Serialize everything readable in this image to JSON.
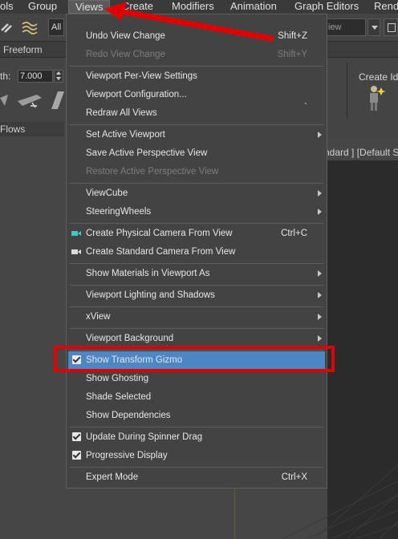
{
  "menubar": {
    "items": [
      "ols",
      "Group",
      "Views",
      "Create",
      "Modifiers",
      "Animation",
      "Graph Editors",
      "Rende"
    ]
  },
  "toolbar": {
    "selection_filter": "All",
    "view_dropdown": "iew"
  },
  "ribbon": {
    "tab_freeform": "Freeform",
    "width_label": "th:",
    "width_value": "7.000",
    "flows_label": "Flows",
    "create_idle_label": "Create Id"
  },
  "viewport": {
    "label": "ndard ] [Default S"
  },
  "views_menu": {
    "items": [
      {
        "label": "Undo View Change",
        "shortcut": "Shift+Z"
      },
      {
        "label": "Redo View Change",
        "shortcut": "Shift+Y"
      },
      {
        "label": "Viewport Per-View Settings"
      },
      {
        "label": "Viewport Configuration..."
      },
      {
        "label": "Redraw All Views",
        "shortcut": "`"
      },
      {
        "label": "Set Active Viewport"
      },
      {
        "label": "Save Active Perspective View"
      },
      {
        "label": "Restore Active Perspective View"
      },
      {
        "label": "ViewCube"
      },
      {
        "label": "SteeringWheels"
      },
      {
        "label": "Create Physical Camera From View",
        "shortcut": "Ctrl+C",
        "icon": "physical-camera-icon"
      },
      {
        "label": "Create Standard Camera From View",
        "icon": "standard-camera-icon"
      },
      {
        "label": "Show Materials in Viewport As"
      },
      {
        "label": "Viewport Lighting and Shadows"
      },
      {
        "label": "xView"
      },
      {
        "label": "Viewport Background"
      },
      {
        "label": "Show Transform Gizmo",
        "checked": true,
        "highlighted": true
      },
      {
        "label": "Show Ghosting"
      },
      {
        "label": "Shade Selected"
      },
      {
        "label": "Show Dependencies"
      },
      {
        "label": "Update During Spinner Drag",
        "checked": true
      },
      {
        "label": "Progressive Display",
        "checked": true
      },
      {
        "label": "Expert Mode",
        "shortcut": "Ctrl+X"
      }
    ]
  },
  "colors": {
    "highlight": "#4d86c4",
    "annotation": "#e10000",
    "menu_bg": "#434343"
  }
}
